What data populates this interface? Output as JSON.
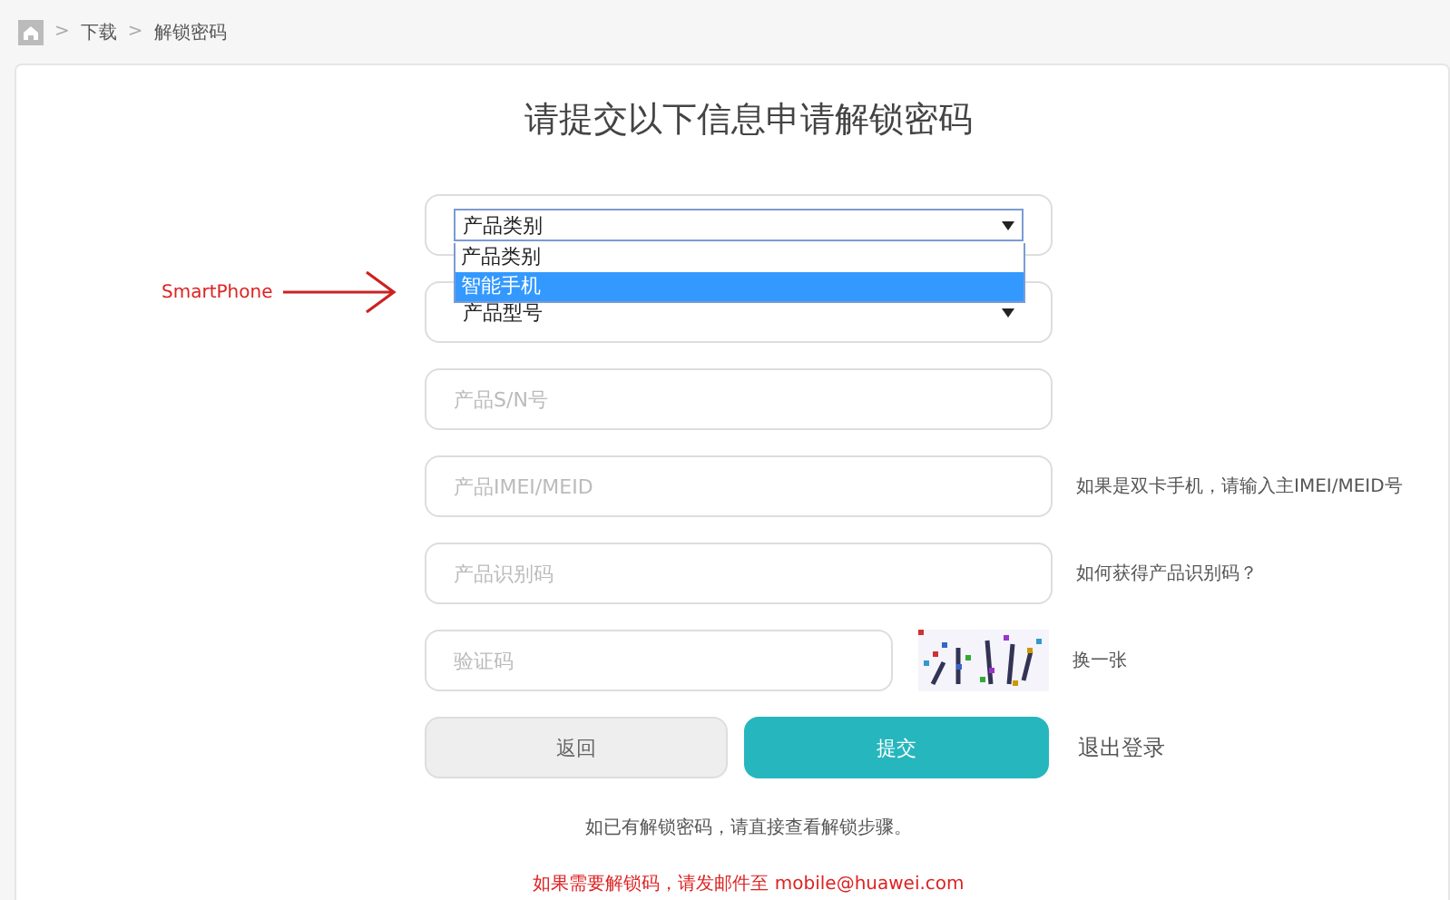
{
  "breadcrumb": [
    {
      "separator": ">",
      "label": "下载"
    },
    {
      "separator": ">",
      "label": "解锁密码"
    }
  ],
  "title": "请提交以下信息申请解锁密码",
  "annotation": {
    "label": "SmartPhone"
  },
  "fields": [
    {
      "kind": "select",
      "value": "产品类别",
      "open": true,
      "options": [
        {
          "label": "产品类别",
          "highlighted": false
        },
        {
          "label": "智能手机",
          "highlighted": true
        }
      ]
    },
    {
      "kind": "select",
      "value": "产品型号",
      "open": false
    },
    {
      "kind": "input",
      "placeholder": "产品S/N号"
    },
    {
      "kind": "input",
      "placeholder": "产品IMEI/MEID",
      "hint": "如果是双卡手机，请输入主IMEI/MEID号"
    },
    {
      "kind": "input",
      "placeholder": "产品识别码",
      "hint": "如何获得产品识别码？"
    },
    {
      "kind": "captcha",
      "placeholder": "验证码",
      "refresh": "换一张"
    }
  ],
  "buttons": [
    {
      "label": "返回",
      "kind": "secondary"
    },
    {
      "label": "提交",
      "kind": "primary"
    }
  ],
  "logout": "退出登录",
  "note": "如已有解锁密码，请直接查看解锁步骤。",
  "contact": "如果需要解锁码，请发邮件至 mobile@huawei.com"
}
